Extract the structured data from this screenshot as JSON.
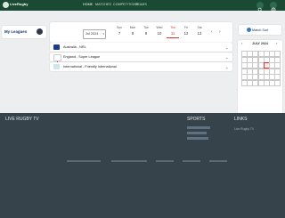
{
  "header": {
    "logo_text": "LiveRugby",
    "nav": [
      "HOME",
      "MATCHES",
      "COMPETITIONS",
      "TEAMS"
    ]
  },
  "sidebar": {
    "my_leagues": "My Leagues"
  },
  "date_bar": {
    "month_label": "Jul 2024",
    "days": [
      {
        "name": "Sun",
        "date": "7"
      },
      {
        "name": "Mon",
        "date": "8"
      },
      {
        "name": "Tue",
        "date": "9"
      },
      {
        "name": "Wed",
        "date": "10"
      },
      {
        "name": "Thu",
        "date": "11"
      },
      {
        "name": "Fri",
        "date": "12"
      },
      {
        "name": "Sat",
        "date": "13"
      }
    ],
    "selected_day": "11"
  },
  "matches": [
    {
      "label": "Australia - NRL"
    },
    {
      "label": "England - Super League"
    },
    {
      "label": "International - Friendly International"
    }
  ],
  "right_panel": {
    "match_sort": "Match Sort",
    "calendar_title": "JULY 2024"
  },
  "footer": {
    "col1_title": "LIVE RUGBY TV",
    "col2_title": "SPORTS",
    "col3_title": "LINKS",
    "col3_link": "Live Rugby TV"
  },
  "colors": {
    "header_bg": "#1b4a34",
    "accent_red": "#d33333",
    "footer_bg": "#36434a"
  }
}
